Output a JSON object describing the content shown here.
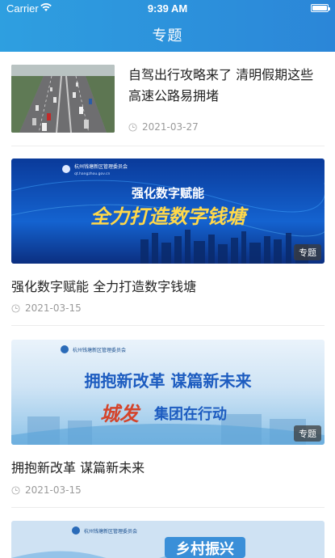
{
  "status_bar": {
    "carrier": "Carrier",
    "time": "9:39 AM"
  },
  "header": {
    "title": "专题"
  },
  "articles": [
    {
      "title": "自驾出行攻略来了 清明假期这些高速公路易拥堵",
      "date": "2021-03-27",
      "thumbnail_icon": "highway-traffic-photo"
    },
    {
      "title": "强化数字赋能 全力打造数字钱塘",
      "date": "2021-03-15",
      "banner": {
        "org": "杭州钱塘新区管理委员会",
        "url": "qt.hangzhou.gov.cn",
        "line1": "强化数字赋能",
        "line2": "全力打造数字钱塘",
        "tag": "专题"
      }
    },
    {
      "title": "拥抱新改革 谋篇新未来",
      "date": "2021-03-15",
      "banner": {
        "org": "杭州钱塘新区管理委员会",
        "line1": "拥抱新改革 谋篇新未来",
        "line2a": "城发",
        "line2b": "集团在行动",
        "tag": "专题"
      }
    },
    {
      "banner": {
        "org": "杭州钱塘新区管理委员会",
        "line1": "乡村振兴"
      }
    }
  ],
  "colors": {
    "header_start": "#2e9fe0",
    "header_end": "#2b86d8",
    "date_text": "#9a9a9a",
    "tag_bg": "#3c3c3c"
  }
}
